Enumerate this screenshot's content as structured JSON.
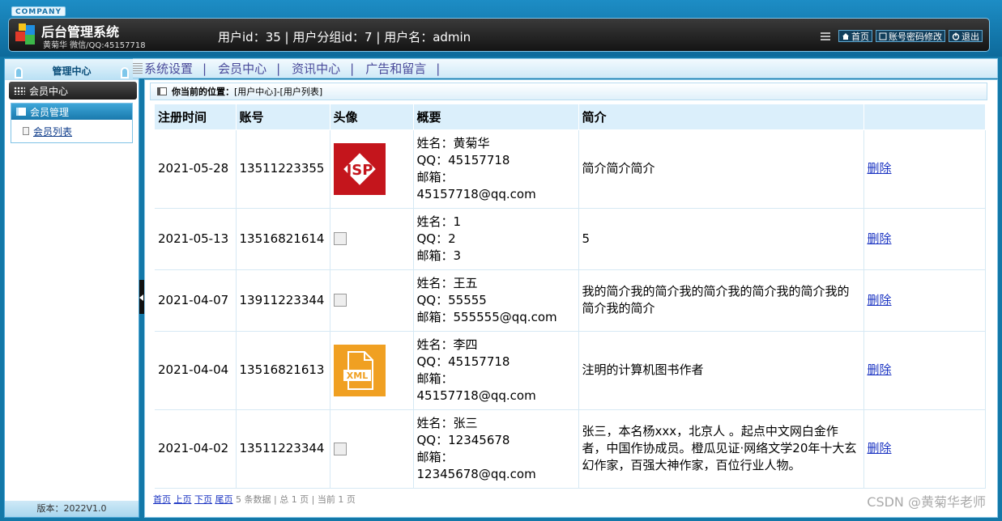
{
  "header": {
    "company": "COMPANY",
    "title": "后台管理系统",
    "subtitle": "黄菊华 微信/QQ:45157718",
    "user_info": "用户id：35 | 用户分组id：7 | 用户名：admin",
    "links": [
      "首页",
      "账号密码修改",
      "退出"
    ]
  },
  "sidebar": {
    "title": "管理中心",
    "section": "会员中心",
    "group": "会员管理",
    "items": [
      "会员列表"
    ],
    "version": "版本：2022V1.0"
  },
  "menu": [
    "系统设置",
    "会员中心",
    "资讯中心",
    "广告和留言"
  ],
  "breadcrumb": {
    "label": "你当前的位置：",
    "path": "[用户中心]-[用户列表]"
  },
  "table": {
    "headers": [
      "注册时间",
      "账号",
      "头像",
      "概要",
      "简介",
      ""
    ],
    "rows": [
      {
        "time": "2021-05-28",
        "account": "13511223355",
        "avatar": "JSP",
        "summary": [
          "姓名：黄菊华",
          "QQ：45157718",
          "邮箱：",
          "45157718@qq.com"
        ],
        "intro": "简介简介简介",
        "op": "删除"
      },
      {
        "time": "2021-05-13",
        "account": "13516821614",
        "avatar": "",
        "summary": [
          "姓名：1",
          "QQ：2",
          "邮箱：3"
        ],
        "intro": "5",
        "op": "删除"
      },
      {
        "time": "2021-04-07",
        "account": "13911223344",
        "avatar": "",
        "summary": [
          "姓名：王五",
          "QQ：55555",
          "邮箱：555555@qq.com"
        ],
        "intro": "我的简介我的简介我的简介我的简介我的简介我的简介我的简介",
        "op": "删除"
      },
      {
        "time": "2021-04-04",
        "account": "13516821613",
        "avatar": "XML",
        "summary": [
          "姓名：李四",
          "QQ：45157718",
          "邮箱：",
          "45157718@qq.com"
        ],
        "intro": "注明的计算机图书作者",
        "op": "删除"
      },
      {
        "time": "2021-04-02",
        "account": "13511223344",
        "avatar": "",
        "summary": [
          "姓名：张三",
          "QQ：12345678",
          "邮箱：",
          "12345678@qq.com"
        ],
        "intro": "张三，本名杨xxx，北京人 。起点中文网白金作者，中国作协成员。橙瓜见证·网络文学20年十大玄幻作家，百强大神作家，百位行业人物。",
        "op": "删除"
      }
    ]
  },
  "pager": {
    "links": [
      "首页",
      "上页",
      "下页",
      "尾页"
    ],
    "info": "5 条数据 | 总 1 页 | 当前 1 页"
  },
  "watermark": "CSDN @黄菊华老师"
}
